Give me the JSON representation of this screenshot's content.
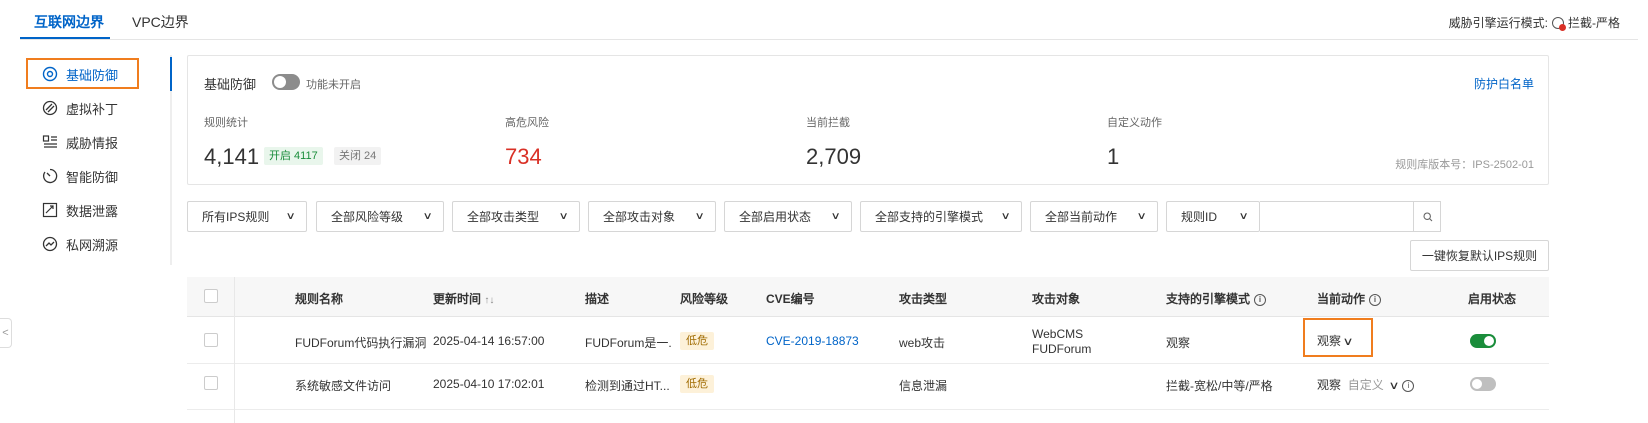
{
  "tabs": [
    "互联网边界",
    "VPC边界"
  ],
  "engine_mode": {
    "label": "威胁引擎运行模式:",
    "value": "拦截-严格"
  },
  "sidebar": {
    "items": [
      {
        "label": "基础防御",
        "icon": "shield-icon"
      },
      {
        "label": "虚拟补丁",
        "icon": "patch-icon"
      },
      {
        "label": "威胁情报",
        "icon": "intel-icon"
      },
      {
        "label": "智能防御",
        "icon": "smart-icon"
      },
      {
        "label": "数据泄露",
        "icon": "leak-icon"
      },
      {
        "label": "私网溯源",
        "icon": "trace-icon"
      }
    ]
  },
  "basic_defense": {
    "title": "基础防御",
    "toggle_label": "功能未开启",
    "whitelist_link": "防护白名单",
    "stats": [
      {
        "label": "规则统计",
        "value": "4,141"
      },
      {
        "label": "高危风险",
        "value": "734"
      },
      {
        "label": "当前拦截",
        "value": "2,709"
      },
      {
        "label": "自定义动作",
        "value": "1"
      }
    ],
    "enabled_pill": "开启 4117",
    "disabled_pill": "关闭 24",
    "version": "规则库版本号：IPS-2502-01"
  },
  "filters": [
    "所有IPS规则",
    "全部风险等级",
    "全部攻击类型",
    "全部攻击对象",
    "全部启用状态",
    "全部支持的引擎模式",
    "全部当前动作",
    "规则ID"
  ],
  "search_icon": "search-icon",
  "restore_button": "一键恢复默认IPS规则",
  "table": {
    "headers": [
      "规则名称",
      "更新时间",
      "描述",
      "风险等级",
      "CVE编号",
      "攻击类型",
      "攻击对象",
      "支持的引擎模式",
      "当前动作",
      "启用状态"
    ],
    "sort_glyph": "↑↓",
    "rows": [
      {
        "name": "FUDForum代码执行漏洞",
        "time": "2025-04-14 16:57:00",
        "desc": "FUDForum是一.",
        "risk": "低危",
        "cve": "CVE-2019-18873",
        "attack_type": "web攻击",
        "target_line1": "WebCMS",
        "target_line2": "FUDForum",
        "engine": "观察",
        "action": "观察",
        "action_extra": "",
        "enabled": true
      },
      {
        "name": "系统敏感文件访问",
        "time": "2025-04-10 17:02:01",
        "desc": "检测到通过HT...",
        "risk": "低危",
        "cve": "",
        "attack_type": "信息泄漏",
        "target_line1": "",
        "target_line2": "",
        "engine": "拦截-宽松/中等/严格",
        "action": "观察",
        "action_extra": "自定义",
        "enabled": false
      }
    ]
  }
}
